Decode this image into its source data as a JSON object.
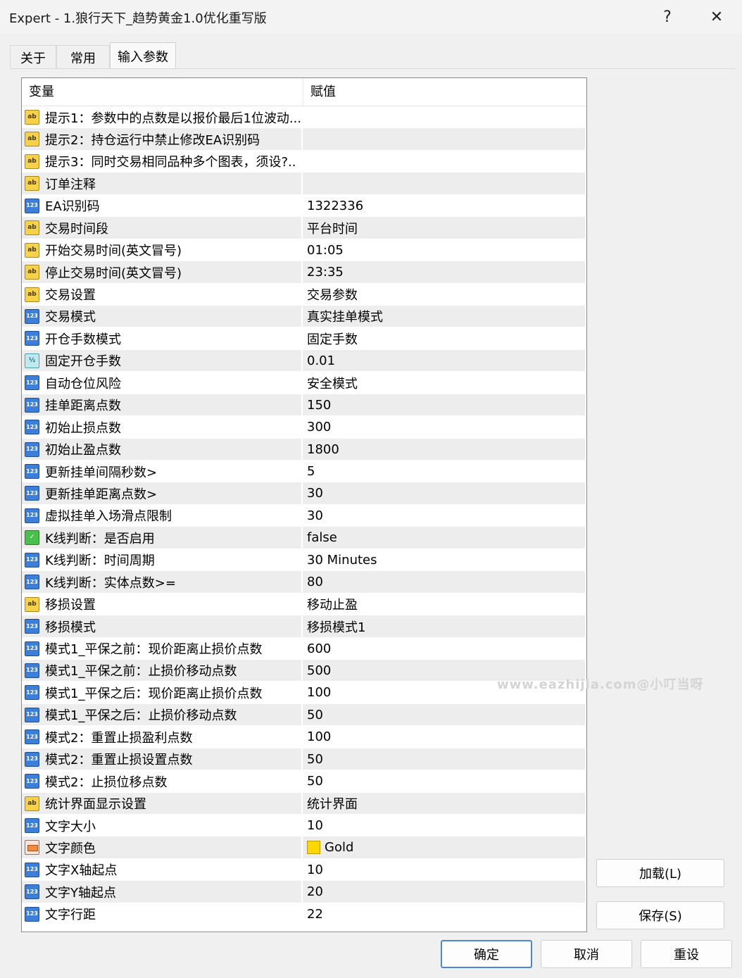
{
  "window": {
    "title": "Expert - 1.狼行天下_趋势黄金1.0优化重写版",
    "help_label": "?",
    "close_label": "✕"
  },
  "tabs": [
    {
      "label": "关于"
    },
    {
      "label": "常用"
    },
    {
      "label": "输入参数"
    }
  ],
  "table": {
    "header_variable": "变量",
    "header_value": "赋值",
    "rows": [
      {
        "icon": "ab",
        "name": "提示1：参数中的点数是以报价最后1位波动...",
        "value": ""
      },
      {
        "icon": "ab",
        "name": "提示2：持仓运行中禁止修改EA识别码",
        "value": ""
      },
      {
        "icon": "ab",
        "name": "提示3：同时交易相同品种多个图表，须设?..",
        "value": ""
      },
      {
        "icon": "ab",
        "name": "订单注释",
        "value": ""
      },
      {
        "icon": "123",
        "name": "EA识别码",
        "value": "1322336"
      },
      {
        "icon": "ab",
        "name": "交易时间段",
        "value": "平台时间"
      },
      {
        "icon": "ab",
        "name": "开始交易时间(英文冒号)",
        "value": "01:05"
      },
      {
        "icon": "ab",
        "name": "停止交易时间(英文冒号)",
        "value": "23:35"
      },
      {
        "icon": "ab",
        "name": "交易设置",
        "value": "交易参数"
      },
      {
        "icon": "123",
        "name": "交易模式",
        "value": "真实挂单模式"
      },
      {
        "icon": "123",
        "name": "开仓手数模式",
        "value": "固定手数"
      },
      {
        "icon": "frac",
        "name": "固定开仓手数",
        "value": "0.01"
      },
      {
        "icon": "123",
        "name": "自动仓位风险",
        "value": "安全模式"
      },
      {
        "icon": "123",
        "name": "挂单距离点数",
        "value": "150"
      },
      {
        "icon": "123",
        "name": "初始止损点数",
        "value": "300"
      },
      {
        "icon": "123",
        "name": "初始止盈点数",
        "value": "1800"
      },
      {
        "icon": "123",
        "name": "更新挂单间隔秒数>",
        "value": "5"
      },
      {
        "icon": "123",
        "name": "更新挂单距离点数>",
        "value": "30"
      },
      {
        "icon": "123",
        "name": "虚拟挂单入场滑点限制",
        "value": "30"
      },
      {
        "icon": "bool",
        "name": "K线判断：是否启用",
        "value": "false"
      },
      {
        "icon": "123",
        "name": "K线判断：时间周期",
        "value": "30 Minutes"
      },
      {
        "icon": "123",
        "name": "K线判断：实体点数>=",
        "value": "80"
      },
      {
        "icon": "ab",
        "name": "移损设置",
        "value": "移动止盈"
      },
      {
        "icon": "123",
        "name": "移损模式",
        "value": "移损模式1"
      },
      {
        "icon": "123",
        "name": "模式1_平保之前：现价距离止损价点数",
        "value": "600"
      },
      {
        "icon": "123",
        "name": "模式1_平保之前：止损价移动点数",
        "value": "500"
      },
      {
        "icon": "123",
        "name": "模式1_平保之后：现价距离止损价点数",
        "value": "100"
      },
      {
        "icon": "123",
        "name": "模式1_平保之后：止损价移动点数",
        "value": "50"
      },
      {
        "icon": "123",
        "name": "模式2：重置止损盈利点数",
        "value": "100"
      },
      {
        "icon": "123",
        "name": "模式2：重置止损设置点数",
        "value": "50"
      },
      {
        "icon": "123",
        "name": "模式2：止损位移点数",
        "value": "50"
      },
      {
        "icon": "ab",
        "name": "统计界面显示设置",
        "value": "统计界面"
      },
      {
        "icon": "123",
        "name": "文字大小",
        "value": "10"
      },
      {
        "icon": "color",
        "name": "文字颜色",
        "value": "Gold",
        "swatch": "#ffd700"
      },
      {
        "icon": "123",
        "name": "文字X轴起点",
        "value": "10"
      },
      {
        "icon": "123",
        "name": "文字Y轴起点",
        "value": "20"
      },
      {
        "icon": "123",
        "name": "文字行距",
        "value": "22"
      }
    ]
  },
  "buttons": {
    "load": "加载(L)",
    "save": "保存(S)",
    "ok": "确定",
    "cancel": "取消",
    "reset": "重设"
  },
  "watermark": "www.eazhijia.com@小叮当呀",
  "colors": {
    "row_alt": "#ededed",
    "ok_border": "#4a88d6",
    "gold": "#ffd700"
  }
}
